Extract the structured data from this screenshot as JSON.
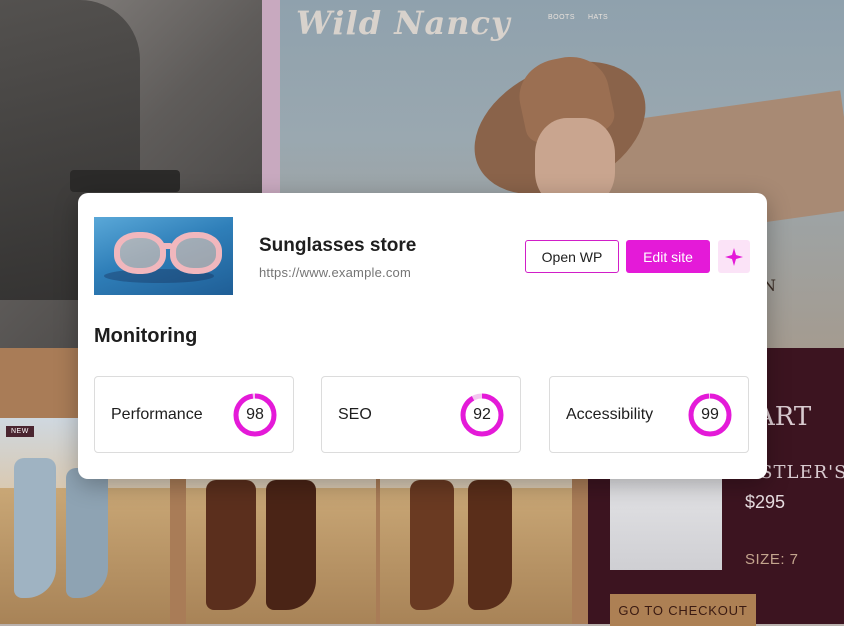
{
  "background": {
    "brand": "Wild Nancy",
    "nav": [
      "BOOTS",
      "HATS"
    ],
    "new_badge": "NEW",
    "hero_letter": "N",
    "cart": {
      "title": "ART",
      "product_name": "USTLER'S",
      "price": "$295",
      "size": "SIZE: 7",
      "checkout_label": "GO TO CHECKOUT"
    }
  },
  "site": {
    "title": "Sunglasses store",
    "url": "https://www.example.com"
  },
  "actions": {
    "open_wp": "Open WP",
    "edit_site": "Edit site",
    "ai_icon": "sparkle-icon"
  },
  "monitoring": {
    "title": "Monitoring",
    "metrics": [
      {
        "label": "Performance",
        "score": 98
      },
      {
        "label": "SEO",
        "score": 92
      },
      {
        "label": "Accessibility",
        "score": 99
      }
    ]
  },
  "colors": {
    "accent": "#e41ad8",
    "gauge_track": "#f3c6ef"
  }
}
